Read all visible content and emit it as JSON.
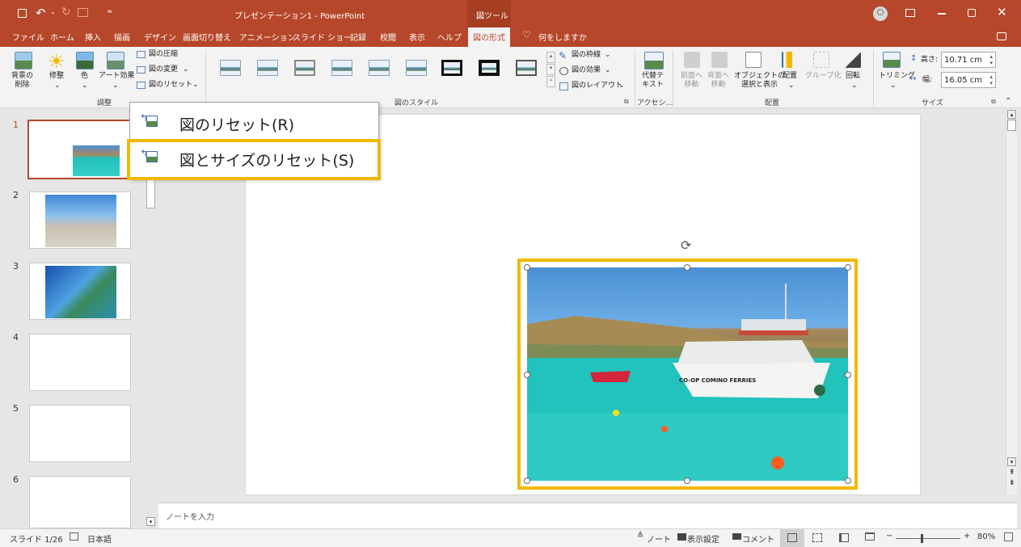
{
  "colors": {
    "accent": "#b7472a",
    "highlight": "#f2b800",
    "picture_selection_border": "#f2b800"
  },
  "titlebar": {
    "title": "プレゼンテーション1 - PowerPoint",
    "context_tab": "図ツール",
    "qat_icons": [
      "save-icon",
      "undo-icon",
      "redo-icon",
      "slideshow-icon",
      "customize-icon"
    ],
    "window_controls": [
      "account-icon",
      "ribbon-display-icon",
      "minimize-icon",
      "restore-icon",
      "close-icon"
    ]
  },
  "tabs": {
    "file": "ファイル",
    "home": "ホーム",
    "insert": "挿入",
    "draw": "描画",
    "design": "デザイン",
    "transitions": "画面切り替え",
    "animations": "アニメーション",
    "slideshow": "スライド ショー",
    "record": "記録",
    "review": "校閲",
    "view": "表示",
    "help": "ヘルプ",
    "picture_format": "図の形式",
    "tell_me": "何をしますか"
  },
  "ribbon": {
    "adjust": {
      "remove_bg": "背景の\n削除",
      "corrections": "修整",
      "color": "色",
      "artistic": "アート効果",
      "compress": "図の圧縮",
      "change": "図の変更",
      "reset": "図のリセット",
      "group": "調整"
    },
    "styles": {
      "border": "図の枠線",
      "effects": "図の効果",
      "layout": "図のレイアウト",
      "group": "図のスタイル"
    },
    "accessibility": {
      "alt_text": "代替テ\nキスト",
      "group": "アクセシ…"
    },
    "arrange": {
      "bring_forward": "前面へ\n移動",
      "send_backward": "背面へ\n移動",
      "selection_pane": "オブジェクトの\n選択と表示",
      "align": "配置",
      "group_btn": "グループ化",
      "rotate": "回転",
      "group": "配置"
    },
    "size": {
      "crop": "トリミング",
      "height_label": "高さ:",
      "height_value": "10.71 cm",
      "width_label": "幅:",
      "width_value": "16.05 cm",
      "group": "サイズ"
    }
  },
  "dropdown": {
    "reset_picture": "図のリセット(R)",
    "reset_picture_and_size": "図とサイズのリセット(S)"
  },
  "slides": [
    {
      "num": "1",
      "has_image": true
    },
    {
      "num": "2",
      "has_image": true
    },
    {
      "num": "3",
      "has_image": true
    },
    {
      "num": "4",
      "has_image": false
    },
    {
      "num": "5",
      "has_image": false
    },
    {
      "num": "6",
      "has_image": false
    }
  ],
  "boat_image": {
    "hull_text": "CO-OP COMINO FERRIES"
  },
  "notes": {
    "placeholder": "ノートを入力"
  },
  "status": {
    "slide_count": "スライド 1/26",
    "language": "日本語",
    "notes_btn": "ノート",
    "display_settings": "表示設定",
    "comments_btn": "コメント",
    "zoom_minus": "−",
    "zoom_plus": "+",
    "zoom": "80%"
  }
}
